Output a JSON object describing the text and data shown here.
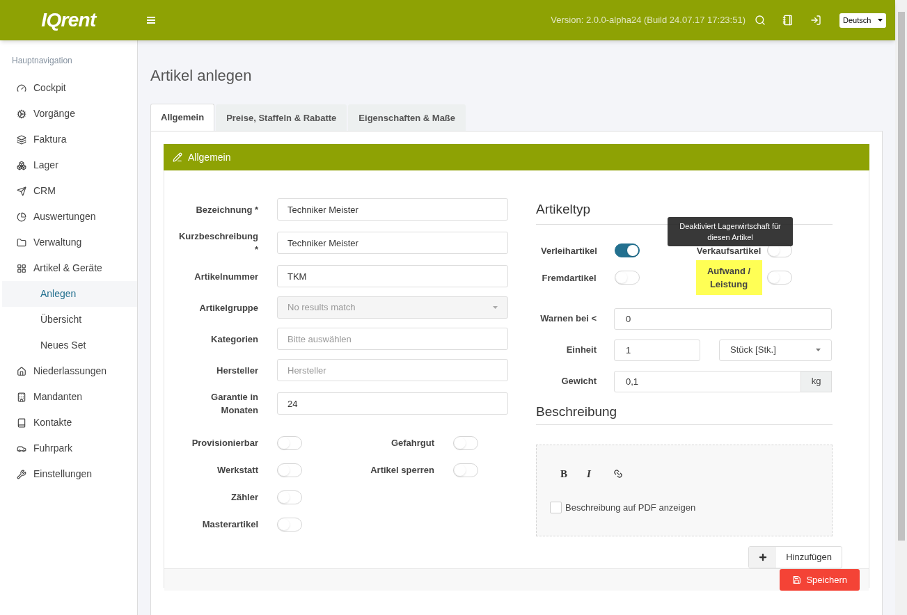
{
  "header": {
    "logo": "IQrent",
    "version": "Version: 2.0.0-alpha24 (Build 24.07.17 17:23:51)",
    "language": "Deutsch"
  },
  "sidebar": {
    "heading": "Hauptnavigation",
    "items": [
      {
        "label": "Cockpit",
        "selected": false
      },
      {
        "label": "Vorgänge",
        "selected": false
      },
      {
        "label": "Faktura",
        "selected": false
      },
      {
        "label": "Lager",
        "selected": false
      },
      {
        "label": "CRM",
        "selected": false
      },
      {
        "label": "Auswertungen",
        "selected": false
      },
      {
        "label": "Verwaltung",
        "selected": false
      },
      {
        "label": "Artikel & Geräte",
        "selected": false,
        "children": [
          {
            "label": "Anlegen",
            "selected": true
          },
          {
            "label": "Übersicht",
            "selected": false
          },
          {
            "label": "Neues Set",
            "selected": false
          }
        ]
      },
      {
        "label": "Niederlassungen",
        "selected": false
      },
      {
        "label": "Mandanten",
        "selected": false
      },
      {
        "label": "Kontakte",
        "selected": false
      },
      {
        "label": "Fuhrpark",
        "selected": false
      },
      {
        "label": "Einstellungen",
        "selected": false
      }
    ]
  },
  "page_title": "Artikel anlegen",
  "tabs": [
    {
      "label": "Allgemein",
      "selected": true
    },
    {
      "label": "Preise, Staffeln & Rabatte",
      "selected": false
    },
    {
      "label": "Eigenschaften & Maße",
      "selected": false
    }
  ],
  "panel_title": "Allgemein",
  "fields": [
    {
      "label": "Bezeichnung",
      "marker": "*",
      "kind": "text",
      "value": "Techniker Meister"
    },
    {
      "label": "Kurzbeschreibung",
      "marker": "*",
      "kind": "text",
      "value": "Techniker Meister"
    },
    {
      "label": "Artikelnummer",
      "kind": "text",
      "value": "TKM"
    },
    {
      "label": "Artikelgruppe",
      "kind": "select",
      "placeholder": "No results match",
      "disabled": true
    },
    {
      "label": "Kategorien",
      "kind": "text",
      "placeholder": "Bitte auswählen"
    },
    {
      "label": "Hersteller",
      "kind": "text",
      "placeholder": "Hersteller"
    },
    {
      "label": "Garantie in Monaten",
      "kind": "text",
      "value": "24"
    }
  ],
  "left_switches": [
    [
      {
        "label": "Provisionierbar",
        "on": false
      },
      {
        "label": "Gefahrgut",
        "on": false
      }
    ],
    [
      {
        "label": "Werkstatt",
        "on": false
      },
      {
        "label": "Artikel sperren",
        "on": false
      }
    ],
    [
      {
        "label": "Zähler",
        "on": false
      }
    ],
    [
      {
        "label": "Masterartikel",
        "on": false
      }
    ]
  ],
  "artikeltyp": {
    "heading": "Artikeltyp",
    "switches": [
      [
        {
          "label": "Verleihartikel",
          "on": true,
          "highlighted": false
        },
        {
          "label": "Verkaufsartikel",
          "on": false,
          "highlighted": false
        }
      ],
      [
        {
          "label": "Fremdartikel",
          "on": false,
          "highlighted": false
        },
        {
          "label": "Aufwand / Leistung",
          "on": false,
          "highlighted": true
        }
      ]
    ],
    "tooltip": "Deaktiviert Lagerwirtschaft für diesen Artikel"
  },
  "warnen": {
    "label": "Warnen bei <",
    "value": "0"
  },
  "einheit": {
    "label": "Einheit",
    "value": "1",
    "unit": "Stück [Stk.]"
  },
  "gewicht": {
    "label": "Gewicht",
    "value": "0,1",
    "addon": "kg"
  },
  "beschreibung": {
    "heading": "Beschreibung",
    "bold": "B",
    "italic": "I",
    "checkbox": {
      "label": "Beschreibung auf PDF anzeigen",
      "checked": false
    }
  },
  "add_button": "Hinzufügen",
  "save_button": "Speichern"
}
